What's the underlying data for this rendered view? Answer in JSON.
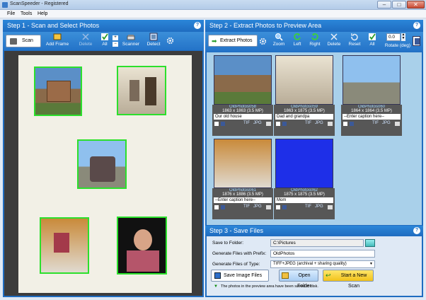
{
  "window": {
    "title": "ScanSpeeder - Registered",
    "min": "–",
    "max": "□",
    "close": "✕"
  },
  "menu": [
    "File",
    "Tools",
    "Help"
  ],
  "step1": {
    "title": "Step 1 - Scan and Select Photos",
    "scan_label": "Scan",
    "add_frame": "Add Frame",
    "delete": "Delete",
    "all": "All",
    "scanner": "Scanner",
    "detect": "Detect",
    "plus": "+",
    "minus": "−"
  },
  "step2": {
    "title": "Step 2 - Extract Photos to Preview Area",
    "extract_label": "Extract Photos",
    "zoom": "Zoom",
    "left": "Left",
    "right": "Right",
    "delete": "Delete",
    "reset": "Reset",
    "all": "All",
    "rotate_value": "0.0",
    "rotate_label": "Rotate (deg)",
    "photos": [
      {
        "name": "OldPhotos058",
        "size": "1863 x 1863 (3.5 MP)",
        "caption": "Our old house",
        "tif": "TIF",
        "jpg": "JPG"
      },
      {
        "name": "OldPhotos059",
        "size": "1863 x 1875 (3.5 MP)",
        "caption": "Dad and grandpa",
        "tif": "TIF",
        "jpg": "JPG"
      },
      {
        "name": "OldPhotos060",
        "size": "1864 x 1864 (3.5 MP)",
        "caption": "--Enter caption here--",
        "tif": "TIF",
        "jpg": "JPG"
      },
      {
        "name": "OldPhotos061",
        "size": "1876 x 1886 (3.5 MP)",
        "caption": "--Enter caption here--",
        "tif": "TIF",
        "jpg": "JPG"
      },
      {
        "name": "OldPhotos062",
        "size": "1875 x 1875 (3.5 MP)",
        "caption": "Mom",
        "tif": "TIF",
        "jpg": "JPG"
      }
    ]
  },
  "step3": {
    "title": "Step 3 - Save Files",
    "save_folder_label": "Save to Folder:",
    "save_folder_value": "C:\\Pictures",
    "prefix_label": "Generate Files with Prefix:",
    "prefix_value": "OldPhotos",
    "type_label": "Generate Files of Type:",
    "type_value": "TIFF+JPEG (archival + sharing quality)",
    "save_button": "Save Image Files",
    "open_folder": "Open Folder",
    "new_scan": "Start a New Scan",
    "status": "The photos in the preview area have been saved to disk."
  },
  "help": "?"
}
